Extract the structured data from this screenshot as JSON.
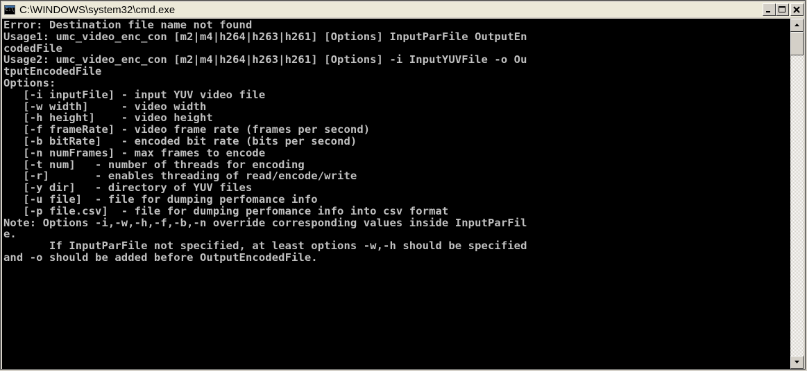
{
  "window": {
    "title": "C:\\WINDOWS\\system32\\cmd.exe",
    "app_icon": "console-icon",
    "icon_text": "C:\\"
  },
  "caption_buttons": {
    "minimize_icon": "minimize-icon",
    "maximize_icon": "maximize-icon",
    "close_icon": "close-icon"
  },
  "console": {
    "lines": [
      "Error: Destination file name not found",
      "Usage1: umc_video_enc_con [m2|m4|h264|h263|h261] [Options] InputParFile OutputEn",
      "codedFile",
      "Usage2: umc_video_enc_con [m2|m4|h264|h263|h261] [Options] -i InputYUVFile -o Ou",
      "tputEncodedFile",
      "Options:",
      "   [-i inputFile] - input YUV video file",
      "   [-w width]     - video width",
      "   [-h height]    - video height",
      "   [-f frameRate] - video frame rate (frames per second)",
      "   [-b bitRate]   - encoded bit rate (bits per second)",
      "   [-n numFrames] - max frames to encode",
      "   [-t num]   - number of threads for encoding",
      "   [-r]       - enables threading of read/encode/write",
      "   [-y dir]   - directory of YUV files",
      "   [-u file]  - file for dumping perfomance info",
      "   [-p file.csv]  - file for dumping perfomance info into csv format",
      "Note: Options -i,-w,-h,-f,-b,-n override corresponding values inside InputParFil",
      "e.",
      "       If InputParFile not specified, at least options -w,-h should be specified",
      "and -o should be added before OutputEncodedFile.",
      "",
      ""
    ]
  },
  "scrollbar": {
    "up_icon": "scroll-up-arrow-icon",
    "down_icon": "scroll-down-arrow-icon",
    "position_fraction": 0.0
  },
  "colors": {
    "console_bg": "#000000",
    "console_fg": "#c0c0c0",
    "titlebar_bg": "#ece9d8"
  }
}
